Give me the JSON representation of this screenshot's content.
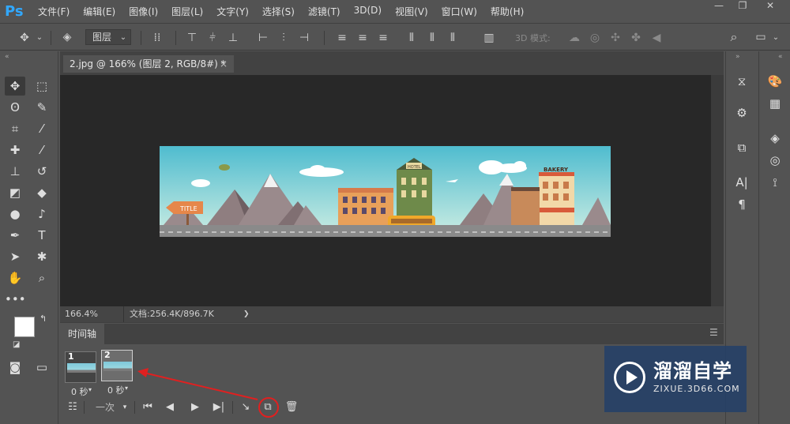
{
  "app": {
    "logo": "Ps"
  },
  "menu": {
    "items": [
      "文件(F)",
      "编辑(E)",
      "图像(I)",
      "图层(L)",
      "文字(Y)",
      "选择(S)",
      "滤镜(T)",
      "3D(D)",
      "视图(V)",
      "窗口(W)",
      "帮助(H)"
    ]
  },
  "window_controls": {
    "minimize": "—",
    "restore": "❐",
    "close": "✕"
  },
  "options": {
    "auto_select_target": "图层",
    "mode_3d_label": "3D 模式:"
  },
  "document": {
    "tab_title": "2.jpg @ 166% (图层 2, RGB/8#) *",
    "tab_close": "×"
  },
  "status": {
    "zoom": "166.4%",
    "doc_info": "文档:256.4K/896.7K",
    "arrow": "❯"
  },
  "banner": {
    "title_sign": "TITLE",
    "hotel": "HOTEL",
    "bakery": "BAKERY"
  },
  "timeline": {
    "tab_label": "时间轴",
    "frames": [
      {
        "number": "1",
        "delay": "0 秒"
      },
      {
        "number": "2",
        "delay": "0 秒"
      }
    ],
    "loop": "一次"
  },
  "watermark": {
    "brand": "溜溜自学",
    "url": "ZIXUE.3D66.COM"
  },
  "colors": {
    "accent": "#31a8ff",
    "annotation": "#e02020",
    "sky": "#5ec1d4"
  }
}
